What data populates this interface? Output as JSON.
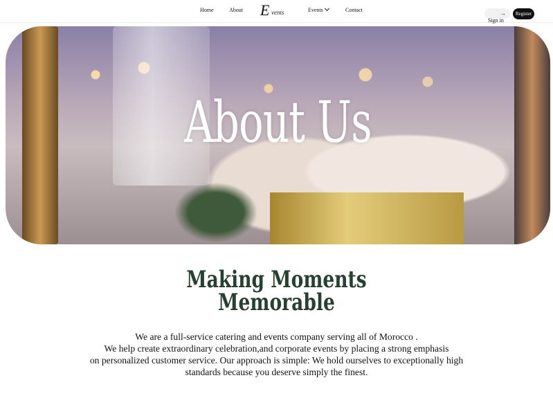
{
  "nav": {
    "links": [
      "Home",
      "About"
    ],
    "logo_big": "E",
    "logo_small": "vents",
    "events_label": "Events",
    "contact_label": "Contact",
    "signin_label": "Sign in",
    "signin_arrow": "→",
    "register_label": "Register"
  },
  "hero": {
    "title": "About Us"
  },
  "content": {
    "headline_1": "Making Moments",
    "headline_2": "Memorable",
    "paragraph_lines": [
      "We are a full-service catering and events company serving  all of Morocco .",
      "We help create extraordinary celebration,and corporate events by placing a strong emphasis",
      "on personalized customer service. Our approach is simple: We hold ourselves to exceptionally high",
      "standards because you deserve simply the finest."
    ]
  },
  "colors": {
    "accent_logo": "#e8a489",
    "headline": "#26412f",
    "register_bg": "#111111"
  }
}
